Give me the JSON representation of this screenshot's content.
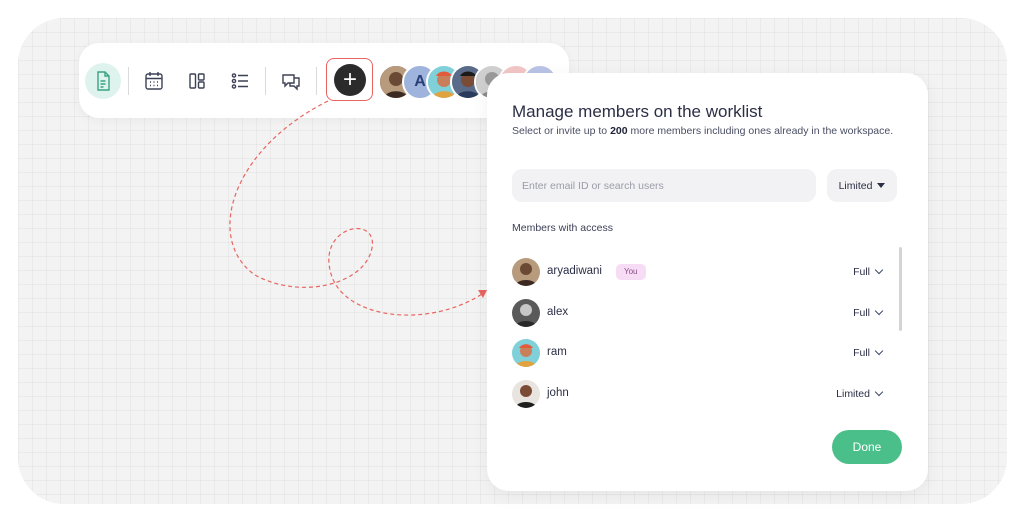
{
  "toolbar": {
    "icons": [
      "document-icon",
      "calendar-icon",
      "board-icon",
      "list-icon",
      "chat-icon"
    ],
    "add_label": "+",
    "avatar_letter": "A"
  },
  "dialog": {
    "title": "Manage members on the worklist",
    "subtitle_pre": "Select or invite up to ",
    "subtitle_count": "200",
    "subtitle_post": " more members including ones already in the workspace.",
    "search_placeholder": "Enter email ID or search users",
    "access_level": "Limited",
    "members_label": "Members with access",
    "members": [
      {
        "name": "aryadiwani",
        "badge": "You",
        "permission": "Full"
      },
      {
        "name": "alex",
        "permission": "Full"
      },
      {
        "name": "ram",
        "permission": "Full"
      },
      {
        "name": "john",
        "permission": "Limited"
      }
    ],
    "done_label": "Done"
  },
  "colors": {
    "accent": "#4bbf8a",
    "highlight": "#e8645f",
    "badge": "#f7dcf6"
  }
}
